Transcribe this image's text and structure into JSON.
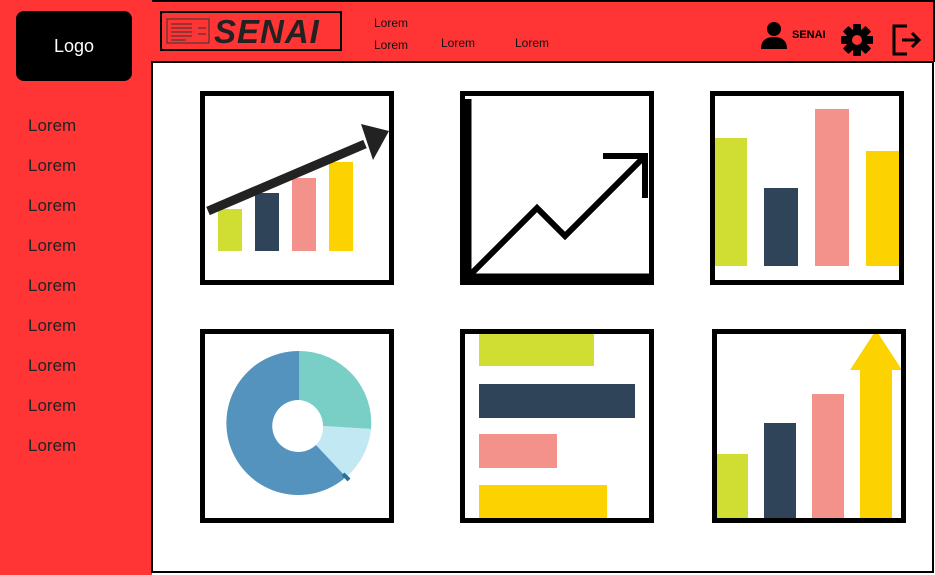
{
  "sidebar": {
    "logo_label": "Logo",
    "items": [
      {
        "label": "Lorem"
      },
      {
        "label": "Lorem"
      },
      {
        "label": "Lorem"
      },
      {
        "label": "Lorem"
      },
      {
        "label": "Lorem"
      },
      {
        "label": "Lorem"
      },
      {
        "label": "Lorem"
      },
      {
        "label": "Lorem"
      },
      {
        "label": "Lorem"
      }
    ]
  },
  "header": {
    "brand": "SENAI",
    "nav": [
      {
        "label": "Lorem"
      },
      {
        "label": "Lorem"
      },
      {
        "label": "Lorem"
      },
      {
        "label": "Lorem"
      }
    ],
    "user_name": "SENAI",
    "icons": [
      "user-icon",
      "gear-icon",
      "logout-icon"
    ]
  },
  "tiles": [
    {
      "icon": "growth-bar-chart-icon"
    },
    {
      "icon": "line-trend-icon"
    },
    {
      "icon": "column-chart-icon"
    },
    {
      "icon": "donut-chart-icon"
    },
    {
      "icon": "horizontal-bar-chart-icon"
    },
    {
      "icon": "rising-bars-arrow-icon"
    }
  ],
  "colors": {
    "accent": "#ff3535",
    "lime": "#d0de34",
    "navy": "#2f4459",
    "salmon": "#f3928a",
    "yellow": "#fcd200",
    "teal": "#79cfc6",
    "blue": "#5593bf",
    "light_blue": "#c2e9f3"
  }
}
